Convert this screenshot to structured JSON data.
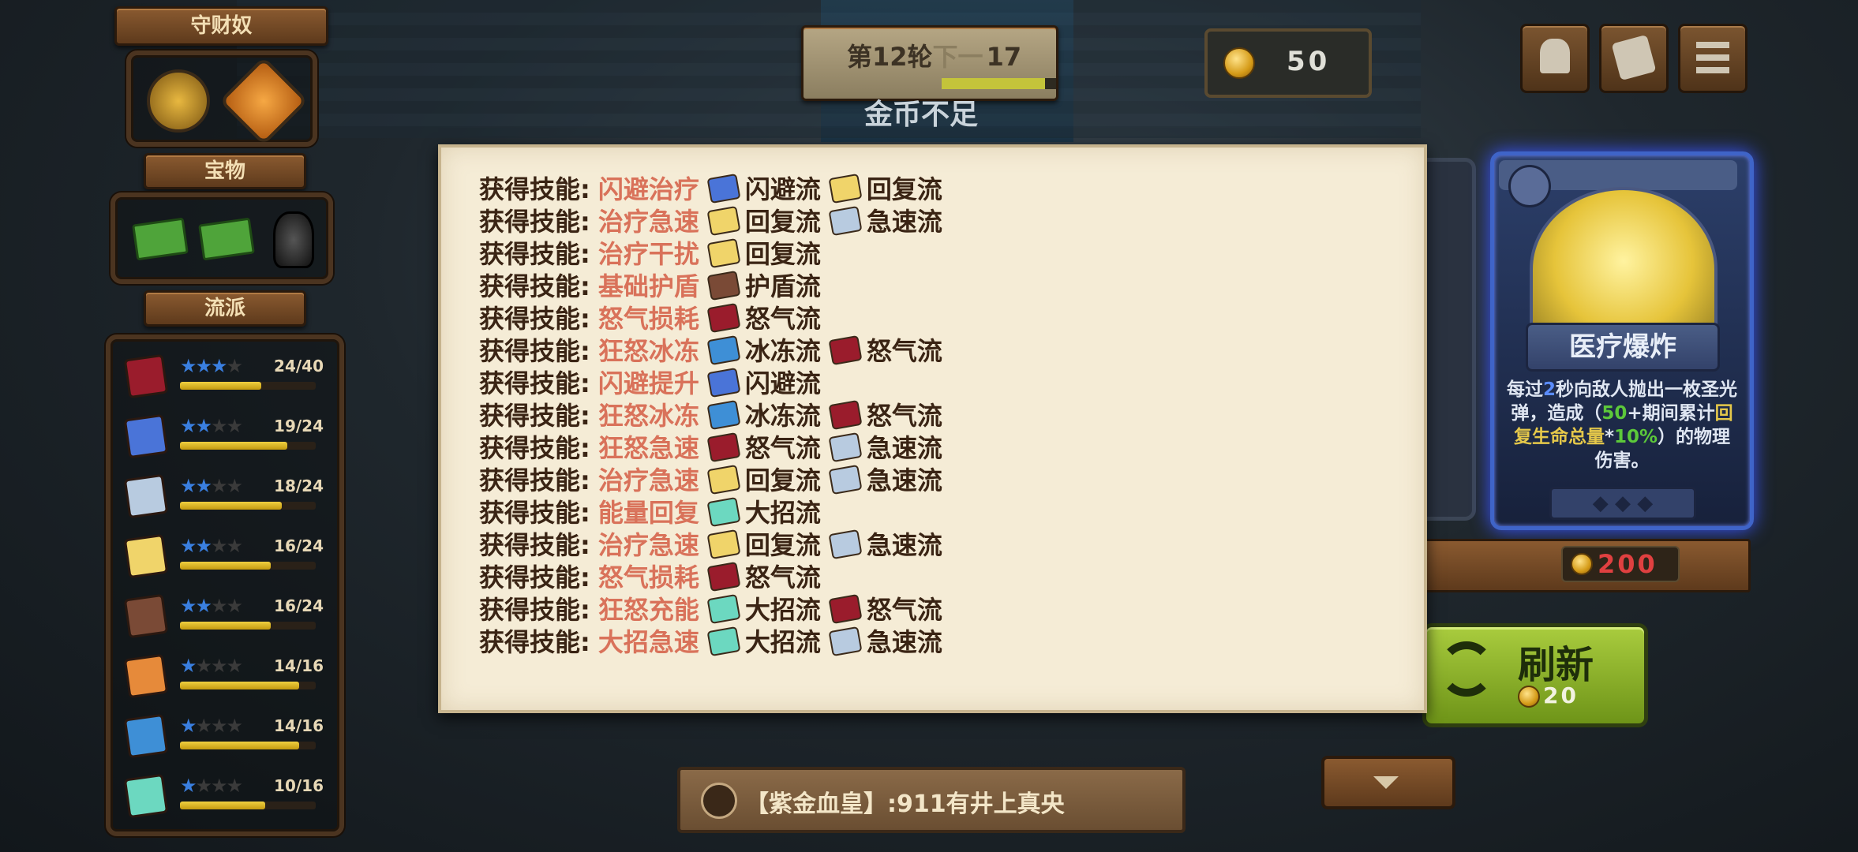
{
  "sidebar": {
    "treasure_guard_label": "守财奴",
    "treasure_label": "宝物",
    "styles_label": "流派",
    "styles": [
      {
        "icon": "rage-book-icon",
        "stars": 3,
        "count": "24/40",
        "progress": 0.6,
        "color": "#9a1c2c"
      },
      {
        "icon": "dodge-book-icon",
        "stars": 2,
        "count": "19/24",
        "progress": 0.79,
        "color": "#4a74d8"
      },
      {
        "icon": "speed-book-icon",
        "stars": 2,
        "count": "18/24",
        "progress": 0.75,
        "color": "#b8cbe0"
      },
      {
        "icon": "heal-book-icon",
        "stars": 2,
        "count": "16/24",
        "progress": 0.67,
        "color": "#f0d46a"
      },
      {
        "icon": "shield-book-icon",
        "stars": 2,
        "count": "16/24",
        "progress": 0.67,
        "color": "#7a4a36"
      },
      {
        "icon": "coin-book-icon",
        "stars": 1,
        "count": "14/16",
        "progress": 0.88,
        "color": "#e68a3a"
      },
      {
        "icon": "ice-book-icon",
        "stars": 1,
        "count": "14/16",
        "progress": 0.88,
        "color": "#3e8fd6"
      },
      {
        "icon": "ult-book-icon",
        "stars": 1,
        "count": "10/16",
        "progress": 0.63,
        "color": "#6cd8c0"
      }
    ]
  },
  "top": {
    "round_label": "第12轮",
    "round_value": "17",
    "round_obscured": "下一",
    "warning": "金币不足",
    "coins": "50"
  },
  "dialog": {
    "prefix": "获得技能:",
    "lines": [
      {
        "skill": "闪避治疗",
        "tags": [
          {
            "name": "闪避流",
            "cls": "c-dodge"
          },
          {
            "name": "回复流",
            "cls": "c-heal"
          }
        ]
      },
      {
        "skill": "治疗急速",
        "tags": [
          {
            "name": "回复流",
            "cls": "c-heal"
          },
          {
            "name": "急速流",
            "cls": "c-speed"
          }
        ]
      },
      {
        "skill": "治疗干扰",
        "tags": [
          {
            "name": "回复流",
            "cls": "c-heal"
          }
        ]
      },
      {
        "skill": "基础护盾",
        "tags": [
          {
            "name": "护盾流",
            "cls": "c-shield"
          }
        ]
      },
      {
        "skill": "怒气损耗",
        "tags": [
          {
            "name": "怒气流",
            "cls": "c-rage"
          }
        ]
      },
      {
        "skill": "狂怒冰冻",
        "tags": [
          {
            "name": "冰冻流",
            "cls": "c-ice"
          },
          {
            "name": "怒气流",
            "cls": "c-rage"
          }
        ]
      },
      {
        "skill": "闪避提升",
        "tags": [
          {
            "name": "闪避流",
            "cls": "c-dodge"
          }
        ]
      },
      {
        "skill": "狂怒冰冻",
        "tags": [
          {
            "name": "冰冻流",
            "cls": "c-ice"
          },
          {
            "name": "怒气流",
            "cls": "c-rage"
          }
        ]
      },
      {
        "skill": "狂怒急速",
        "tags": [
          {
            "name": "怒气流",
            "cls": "c-rage"
          },
          {
            "name": "急速流",
            "cls": "c-speed"
          }
        ]
      },
      {
        "skill": "治疗急速",
        "tags": [
          {
            "name": "回复流",
            "cls": "c-heal"
          },
          {
            "name": "急速流",
            "cls": "c-speed"
          }
        ]
      },
      {
        "skill": "能量回复",
        "tags": [
          {
            "name": "大招流",
            "cls": "c-ult"
          }
        ]
      },
      {
        "skill": "治疗急速",
        "tags": [
          {
            "name": "回复流",
            "cls": "c-heal"
          },
          {
            "name": "急速流",
            "cls": "c-speed"
          }
        ]
      },
      {
        "skill": "怒气损耗",
        "tags": [
          {
            "name": "怒气流",
            "cls": "c-rage"
          }
        ]
      },
      {
        "skill": "狂怒充能",
        "tags": [
          {
            "name": "大招流",
            "cls": "c-ult"
          },
          {
            "name": "怒气流",
            "cls": "c-rage"
          }
        ]
      },
      {
        "skill": "大招急速",
        "tags": [
          {
            "name": "大招流",
            "cls": "c-ult"
          },
          {
            "name": "急速流",
            "cls": "c-speed"
          }
        ]
      }
    ]
  },
  "card": {
    "title": "医疗爆炸",
    "desc_parts": [
      "每过",
      "2",
      "秒向敌人抛出一枚圣光弹，造成（",
      "50",
      "+期间累计",
      "回复生命总量",
      "*",
      "10%",
      "）的物理伤害。"
    ],
    "price": "200"
  },
  "refresh": {
    "label": "刷新",
    "cost": "20"
  },
  "chat": {
    "message": "【紫金血皇】:911有井上真央"
  },
  "colors": {
    "card_border": "#3f64c8",
    "skill_text": "#d9725a",
    "refresh_green": "#7aa22a"
  }
}
